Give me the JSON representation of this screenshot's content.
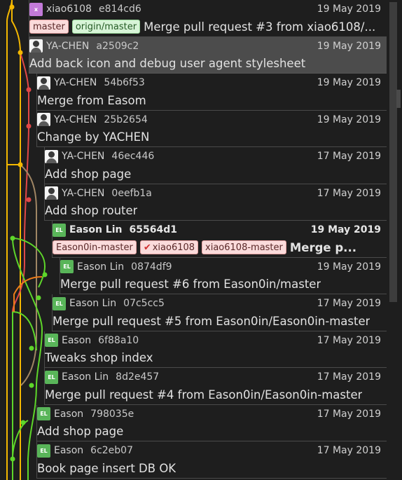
{
  "commits": [
    {
      "author": "xiao6108",
      "hash": "e814cd6",
      "date": "19 May 2019",
      "message": "Merge pull request #3 from xiao6108/...",
      "avatar": "x",
      "avatar_color": "#c27ad8",
      "refs": [
        {
          "label": "master",
          "type": "local"
        },
        {
          "label": "origin/master",
          "type": "remote"
        }
      ]
    },
    {
      "author": "YA-CHEN",
      "hash": "a2509c2",
      "date": "19 May 2019",
      "message": "Add back icon and debug user agent stylesheet",
      "avatar": "user-photo",
      "selected": true,
      "refs": []
    },
    {
      "author": "YA-CHEN",
      "hash": "54b6f53",
      "date": "19 May 2019",
      "message": "Merge from Easom",
      "avatar": "user-photo",
      "refs": []
    },
    {
      "author": "YA-CHEN",
      "hash": "25b2654",
      "date": "19 May 2019",
      "message": "Change by YACHEN",
      "avatar": "user-photo",
      "refs": []
    },
    {
      "author": "YA-CHEN",
      "hash": "46ec446",
      "date": "17 May 2019",
      "message": "Add shop page",
      "avatar": "user-photo",
      "refs": []
    },
    {
      "author": "YA-CHEN",
      "hash": "0eefb1a",
      "date": "17 May 2019",
      "message": "Add shop router",
      "avatar": "user-photo",
      "refs": []
    },
    {
      "author": "Eason Lin",
      "hash": "65564d1",
      "date": "19 May 2019",
      "message": "Merge p...",
      "avatar": "EL",
      "avatar_color": "#59b559",
      "bold": true,
      "refs": [
        {
          "label": "Eason0in-master",
          "type": "local"
        },
        {
          "label": "xiao6108",
          "type": "local",
          "checked": true
        },
        {
          "label": "xiao6108-master",
          "type": "local"
        }
      ]
    },
    {
      "author": "Eason Lin",
      "hash": "0874df9",
      "date": "19 May 2019",
      "message": "Merge pull request #6 from Eason0in/master",
      "avatar": "EL",
      "avatar_color": "#59b559",
      "refs": []
    },
    {
      "author": "Eason Lin",
      "hash": "07c5cc5",
      "date": "17 May 2019",
      "message": "Merge pull request #5 from Eason0in/Eason0in-master",
      "avatar": "EL",
      "avatar_color": "#59b559",
      "refs": []
    },
    {
      "author": "Eason",
      "hash": "6f88a10",
      "date": "17 May 2019",
      "message": "Tweaks shop index",
      "avatar": "EL",
      "avatar_color": "#59b559",
      "refs": []
    },
    {
      "author": "Eason Lin",
      "hash": "8d2e457",
      "date": "17 May 2019",
      "message": "Merge pull request #4 from Eason0in/Eason0in-master",
      "avatar": "EL",
      "avatar_color": "#59b559",
      "refs": []
    },
    {
      "author": "Eason",
      "hash": "798035e",
      "date": "17 May 2019",
      "message": "Add shop page",
      "avatar": "EL",
      "avatar_color": "#59b559",
      "refs": []
    },
    {
      "author": "Eason",
      "hash": "6c2eb07",
      "date": "17 May 2019",
      "message": "Book page insert DB OK",
      "avatar": "EL",
      "avatar_color": "#59b559",
      "refs": []
    }
  ],
  "graph_colors": {
    "yellow": "#f5b800",
    "red": "#e04848",
    "tan": "#a08664",
    "green": "#5ed62a",
    "orange": "#ee7d1a"
  }
}
